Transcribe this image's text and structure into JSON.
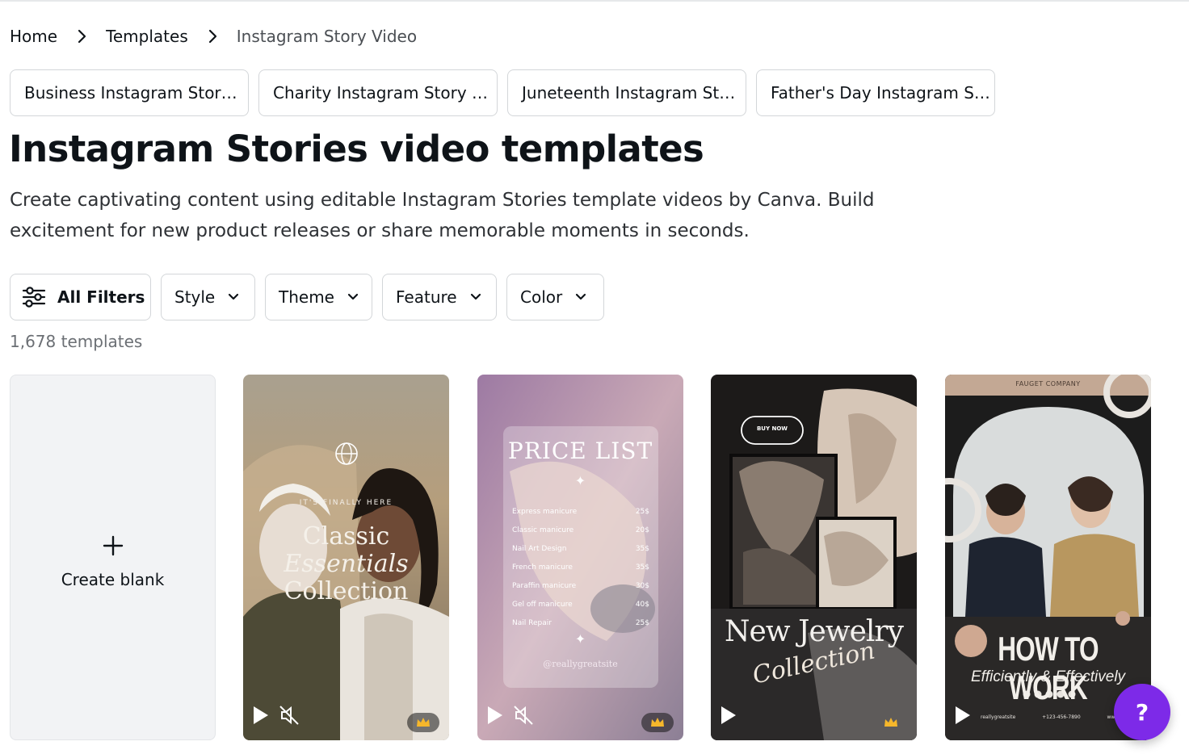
{
  "breadcrumb": {
    "items": [
      {
        "label": "Home"
      },
      {
        "label": "Templates"
      },
      {
        "label": "Instagram Story Video"
      }
    ]
  },
  "related_chips": [
    {
      "label": "Business Instagram Stor…"
    },
    {
      "label": "Charity Instagram Story …"
    },
    {
      "label": "Juneteenth Instagram St…"
    },
    {
      "label": "Father's Day Instagram S…"
    }
  ],
  "page": {
    "title": "Instagram Stories video templates",
    "description": "Create captivating content using editable Instagram Stories template videos by Canva. Build excitement for new product releases or share memorable moments in seconds."
  },
  "filters": {
    "all_filters_label": "All Filters",
    "dropdowns": [
      {
        "label": "Style"
      },
      {
        "label": "Theme"
      },
      {
        "label": "Feature"
      },
      {
        "label": "Color"
      }
    ]
  },
  "results": {
    "count_label": "1,678 templates"
  },
  "create_blank": {
    "icon": "plus-icon",
    "label": "Create blank"
  },
  "templates": [
    {
      "kicker": "IT'S FINALLY HERE",
      "title_line1": "Classic",
      "title_line2": "Essentials",
      "title_line3": "Collection",
      "premium": true,
      "has_audio": true
    },
    {
      "heading": "PRICE LIST",
      "items": [
        {
          "name": "Express manicure",
          "price": "25$"
        },
        {
          "name": "Classic manicure",
          "price": "20$"
        },
        {
          "name": "Nail Art Design",
          "price": "35$"
        },
        {
          "name": "French manicure",
          "price": "35$"
        },
        {
          "name": "Paraffin manicure",
          "price": "30$"
        },
        {
          "name": "Gel off manicure",
          "price": "40$"
        },
        {
          "name": "Nail Repair",
          "price": "25$"
        }
      ],
      "handle": "@reallygreatsite",
      "premium": true,
      "has_audio": true
    },
    {
      "buy_now": "BUY NOW",
      "title": "New Jewelry",
      "script": "Collection",
      "premium": true,
      "has_audio": false
    },
    {
      "company": "FAUGET COMPANY",
      "title": "HOW TO WORK",
      "subtitle": "Efficiently & Effectively",
      "footer_left": "reallygreatsite",
      "footer_mid": "+123-456-7890",
      "footer_right": "www.reallygreat",
      "premium": false,
      "has_audio": false
    }
  ],
  "help": {
    "label": "?"
  },
  "colors": {
    "accent": "#7d2ae8",
    "border": "#d3d6d9",
    "text": "#0e1318"
  }
}
